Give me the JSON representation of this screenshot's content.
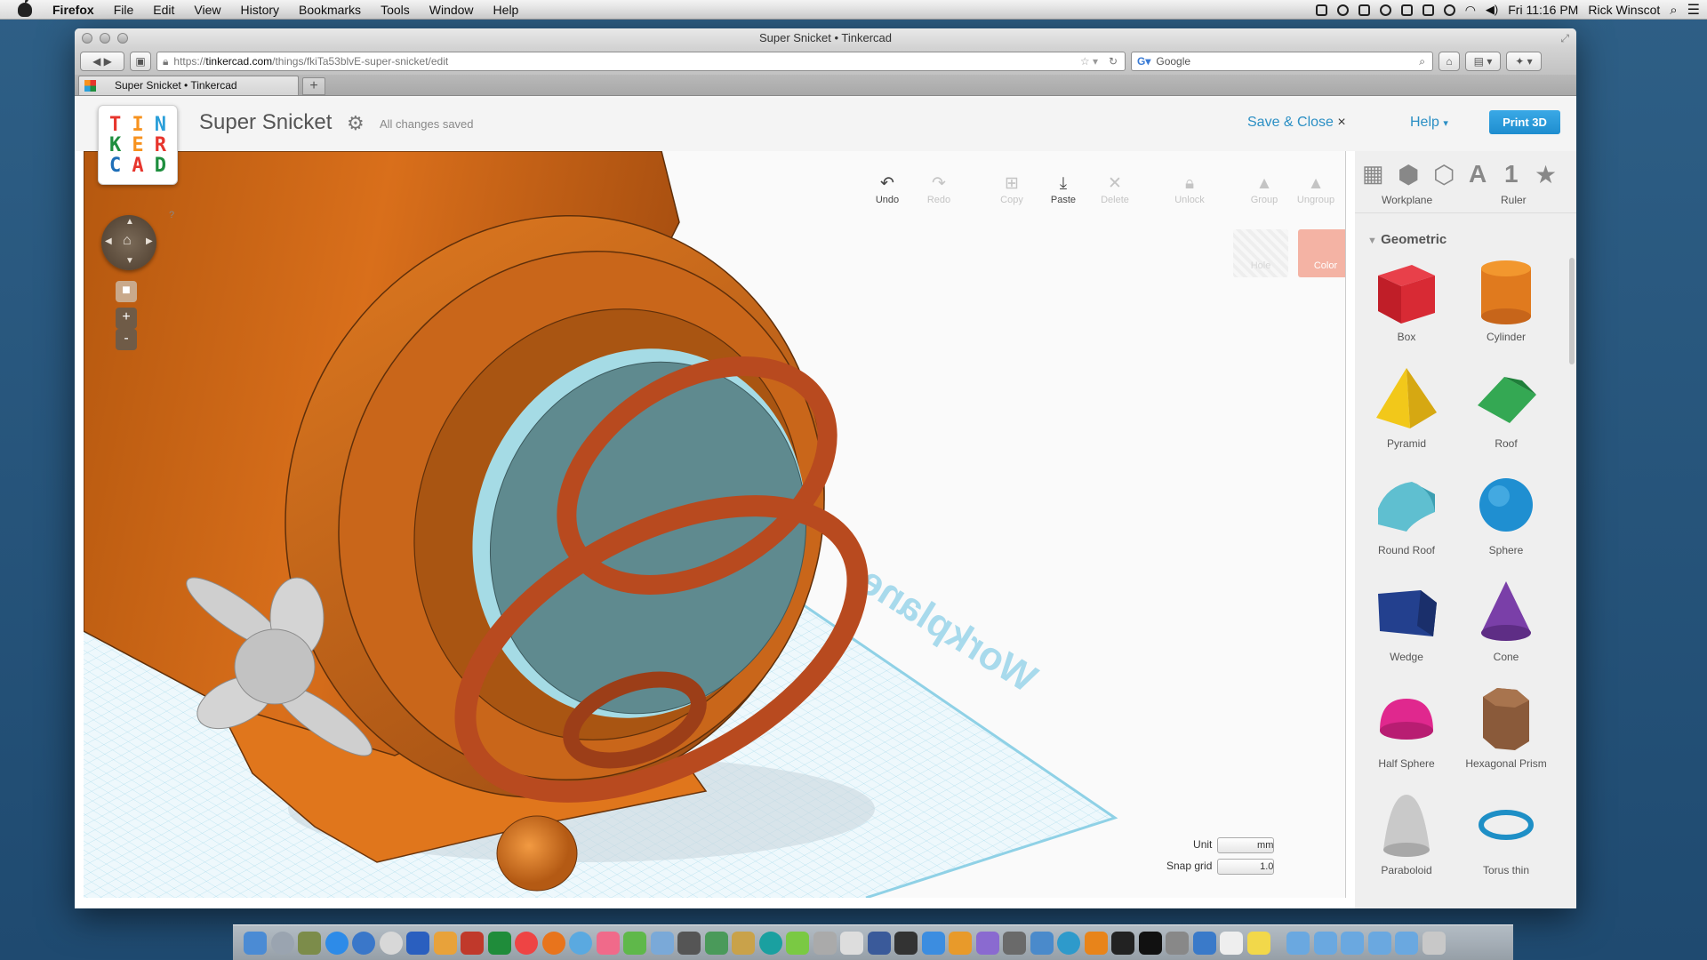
{
  "menubar": {
    "app": "Firefox",
    "items": [
      "File",
      "Edit",
      "View",
      "History",
      "Bookmarks",
      "Tools",
      "Window",
      "Help"
    ],
    "clock": "Fri 11:16 PM",
    "user": "Rick Winscot"
  },
  "window": {
    "title": "Super Snicket • Tinkercad"
  },
  "browser": {
    "url_prefix": "https://",
    "url_host": "tinkercad.com",
    "url_path": "/things/fkiTa53blvE-super-snicket/edit",
    "search_placeholder": "Google",
    "tab_title": "Super Snicket • Tinkercad",
    "new_tab": "+"
  },
  "app": {
    "logo_letters": [
      "T",
      "I",
      "N",
      "K",
      "E",
      "R",
      "C",
      "A",
      "D"
    ],
    "logo_colors": [
      "#e7352d",
      "#f7921e",
      "#2b9fd9",
      "#1e8e3e",
      "#f7921e",
      "#e7352d",
      "#1e6fb8",
      "#e7352d",
      "#1e8e3e"
    ],
    "project_title": "Super Snicket",
    "save_status": "All changes saved",
    "save_close": "Save & Close",
    "save_close_icon": "×",
    "help": "Help",
    "help_caret": "▾",
    "print": "Print 3D"
  },
  "toolbar": {
    "undo": "Undo",
    "redo": "Redo",
    "copy": "Copy",
    "paste": "Paste",
    "delete": "Delete",
    "unlock": "Unlock",
    "group": "Group",
    "ungroup": "Ungroup",
    "hole": "Hole",
    "color": "Color"
  },
  "viewport": {
    "workplane_label": "Workplane",
    "unit_label": "Unit",
    "unit_value": "mm",
    "snap_label": "Snap grid",
    "snap_value": "1.0",
    "zoom_in": "+",
    "zoom_out": "-",
    "help_mark": "?"
  },
  "sidebar": {
    "tab_workplane": "Workplane",
    "tab_ruler": "Ruler",
    "tab_text_glyph": "A",
    "tab_number_glyph": "1",
    "tab_star_glyph": "★",
    "section": "Geometric",
    "shapes": [
      "Box",
      "Cylinder",
      "Pyramid",
      "Roof",
      "Round Roof",
      "Sphere",
      "Wedge",
      "Cone",
      "Half Sphere",
      "Hexagonal Prism",
      "Paraboloid",
      "Torus thin"
    ]
  },
  "colors": {
    "accent": "#2b8fc4",
    "print_button": "#2596d8",
    "model_orange": "#d96f1b",
    "ring_rust": "#b84a1f",
    "disc": "#5f8a8f",
    "grid": "#a9dcec"
  }
}
